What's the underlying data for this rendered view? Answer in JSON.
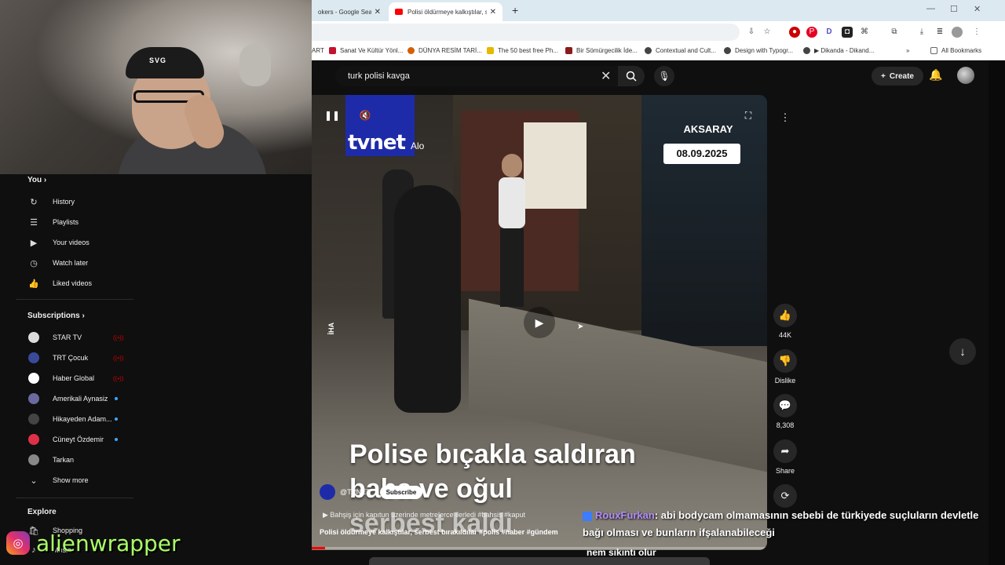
{
  "browser": {
    "tabs": [
      {
        "label": "okers - Google Sear"
      },
      {
        "label": "Polisi öldürmeye kalkıştılar, serb"
      }
    ],
    "bookmarks": [
      {
        "label": "ART",
        "color": "#888888"
      },
      {
        "label": "Sanat Ve Kültür Yönl...",
        "color": "#c4122f"
      },
      {
        "label": "DÜNYA RESİM TARİ...",
        "color": "#d45f00"
      },
      {
        "label": "The 50 best free Ph...",
        "color": "#e6b800"
      },
      {
        "label": "Bir Sömürgecilik İde...",
        "color": "#8b1a1a"
      },
      {
        "label": "Contextual and Cult...",
        "color": "#444444"
      },
      {
        "label": "Design with Typogr...",
        "color": "#444444"
      },
      {
        "label": "▶ Dikanda - Dikand...",
        "color": "#444444"
      },
      {
        "label": "All Bookmarks",
        "color": "#666666"
      }
    ]
  },
  "youtube": {
    "search": {
      "query": "turk polisi kavga"
    },
    "create_label": "Create",
    "sidebar": {
      "you_label": "You",
      "you_items": [
        {
          "label": "History",
          "icon": "↻"
        },
        {
          "label": "Playlists",
          "icon": "☰"
        },
        {
          "label": "Your videos",
          "icon": "▶"
        },
        {
          "label": "Watch later",
          "icon": "◷"
        },
        {
          "label": "Liked videos",
          "icon": "👍"
        }
      ],
      "subs_label": "Subscriptions",
      "subscriptions": [
        {
          "label": "STAR TV",
          "status": "live",
          "color": "#dddddd"
        },
        {
          "label": "TRT Çocuk",
          "status": "live",
          "color": "#3a4a9a"
        },
        {
          "label": "Haber Global",
          "status": "live",
          "color": "#ffffff"
        },
        {
          "label": "Amerikali Aynasiz",
          "status": "new",
          "color": "#6a6aa0"
        },
        {
          "label": "Hikayeden Adam...",
          "status": "new",
          "color": "#444444"
        },
        {
          "label": "Cüneyt Özdemir",
          "status": "new",
          "color": "#e03048"
        },
        {
          "label": "Tarkan",
          "status": "",
          "color": "#888888"
        }
      ],
      "show_more": "Show more",
      "explore_label": "Explore",
      "explore_items": [
        {
          "label": "Shopping"
        },
        {
          "label": "Music"
        }
      ]
    },
    "video": {
      "logo": "tvnet",
      "logo_sub": "Alo",
      "location": "AKSARAY",
      "date": "08.09.2025",
      "watermark": "İHA",
      "headline_lines": [
        "Polise bıçakla saldıran",
        "baba ve oğul",
        "serbest kaldı"
      ],
      "channel": "@TVNET",
      "subscribe": "Subscribe",
      "description": "Bahşiş için kapıtun üzerinde metrelerce ilerledi #bahsis #kaput",
      "caption": "Polisi öldürmeye kalkıştılar, serbest bırakıldılar",
      "tags": "#polis #haber #gündem",
      "progress": 0.03
    },
    "actions": {
      "likes": "44K",
      "dislike": "Dislike",
      "comments": "8,308",
      "share": "Share"
    }
  },
  "stream": {
    "instagram": "alienwrapper",
    "chat_user": "RouxFurkan",
    "chat_message": ": abi bodycam olmamasının sebebi de türkiyede suçluların devletle bağı olması ve bunların ifşalanabileceği",
    "chat_tail": "nem sıkıntı olur",
    "cap_brand": "SVG"
  }
}
